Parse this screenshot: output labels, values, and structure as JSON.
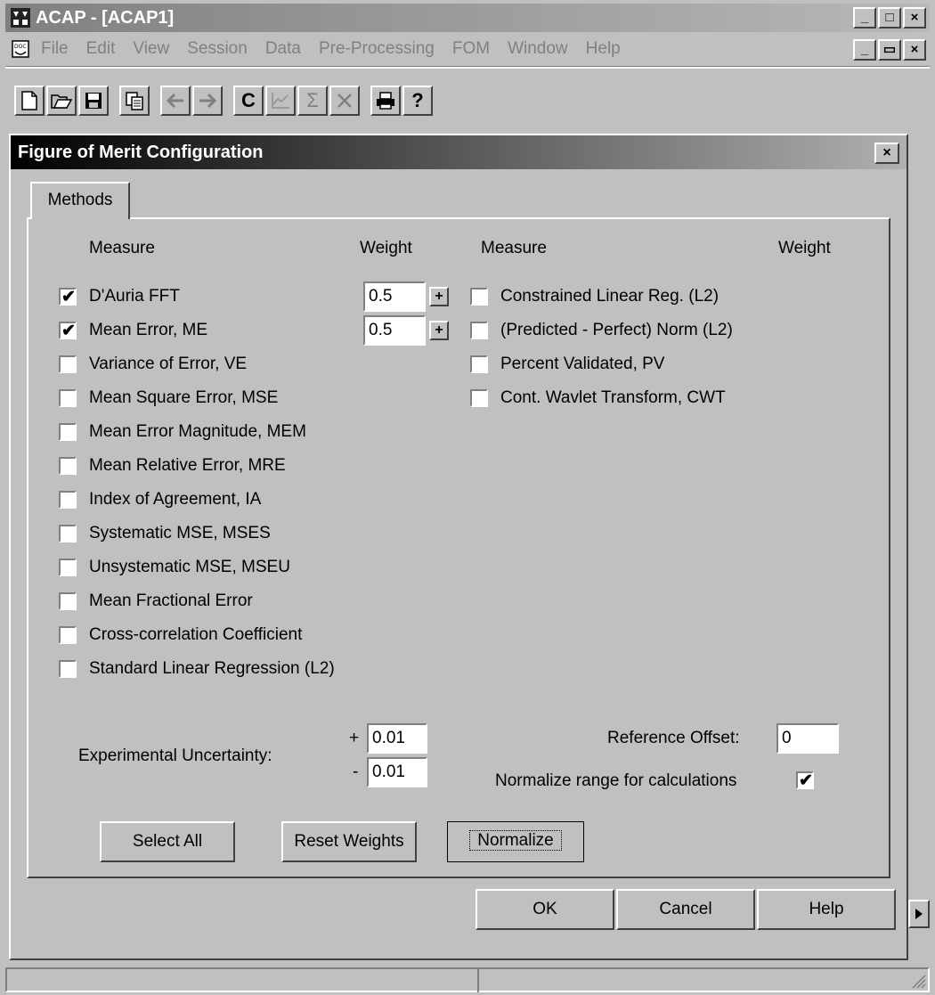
{
  "app": {
    "title": "ACAP - [ACAP1]",
    "menu": [
      "File",
      "Edit",
      "View",
      "Session",
      "Data",
      "Pre-Processing",
      "FOM",
      "Window",
      "Help"
    ],
    "caption_min": "_",
    "caption_max": "□",
    "caption_close": "×",
    "mdi_min": "_",
    "mdi_restore": "▭",
    "mdi_close": "×"
  },
  "toolbar": {
    "icons": [
      "new-file-icon",
      "open-folder-icon",
      "save-disk-icon",
      "copy-icon",
      "back-arrow-icon",
      "forward-arrow-icon",
      "c-icon",
      "chart-icon",
      "sigma-icon",
      "cross-icon",
      "printer-icon",
      "help-icon"
    ],
    "c_label": "C",
    "sigma_label": "Σ",
    "help_label": "?"
  },
  "dialog": {
    "title": "Figure of Merit Configuration",
    "close_label": "×",
    "tab_label": "Methods",
    "headers": {
      "left_measure": "Measure",
      "left_weight": "Weight",
      "right_measure": "Measure",
      "right_weight": "Weight"
    },
    "left_measures": [
      {
        "label": "D'Auria FFT",
        "checked": true,
        "weight": "0.5"
      },
      {
        "label": "Mean Error, ME",
        "checked": true,
        "weight": "0.5"
      },
      {
        "label": "Variance of Error, VE",
        "checked": false
      },
      {
        "label": "Mean Square Error, MSE",
        "checked": false
      },
      {
        "label": "Mean Error Magnitude, MEM",
        "checked": false
      },
      {
        "label": "Mean Relative Error, MRE",
        "checked": false
      },
      {
        "label": "Index of Agreement, IA",
        "checked": false
      },
      {
        "label": "Systematic MSE, MSES",
        "checked": false
      },
      {
        "label": "Unsystematic MSE, MSEU",
        "checked": false
      },
      {
        "label": "Mean Fractional Error",
        "checked": false
      },
      {
        "label": "Cross-correlation Coefficient",
        "checked": false
      },
      {
        "label": "Standard Linear Regression (L2)",
        "checked": false
      }
    ],
    "right_measures": [
      {
        "label": "Constrained Linear Reg. (L2)",
        "checked": false
      },
      {
        "label": "(Predicted - Perfect) Norm (L2)",
        "checked": false
      },
      {
        "label": "Percent Validated, PV",
        "checked": false
      },
      {
        "label": "Cont. Wavlet Transform, CWT",
        "checked": false
      }
    ],
    "spin_label": "+",
    "uncertainty_label": "Experimental Uncertainty:",
    "plus_sign": "+",
    "minus_sign": "-",
    "uncertainty_plus": "0.01",
    "uncertainty_minus": "0.01",
    "reference_offset_label": "Reference Offset:",
    "reference_offset_value": "0",
    "normalize_range_label": "Normalize range for calculations",
    "normalize_range_checked": true,
    "check_mark": "✔",
    "buttons": {
      "select_all": "Select All",
      "reset_weights": "Reset Weights",
      "normalize": "Normalize",
      "ok": "OK",
      "cancel": "Cancel",
      "help": "Help"
    }
  }
}
